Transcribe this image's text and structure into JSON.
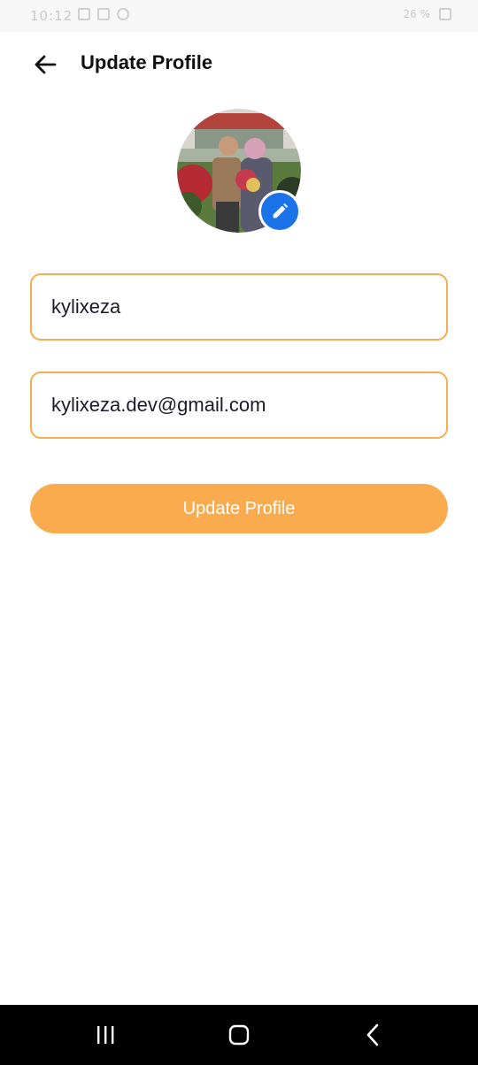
{
  "status_bar": {
    "time": "10:12",
    "right_text": "26 %"
  },
  "header": {
    "title": "Update Profile",
    "back_icon": "arrow-left-icon"
  },
  "avatar": {
    "alt": "Profile photo",
    "edit_icon": "pencil-icon",
    "edit_color": "#1a73e8"
  },
  "form": {
    "name_value": "kylixeza",
    "email_value": "kylixeza.dev@gmail.com",
    "field_border_color": "#f7ad4f"
  },
  "actions": {
    "update_label": "Update Profile",
    "update_color": "#f9ab4d"
  },
  "nav": {
    "recents_icon": "recents-icon",
    "home_icon": "home-icon",
    "back_icon": "back-chevron-icon"
  }
}
